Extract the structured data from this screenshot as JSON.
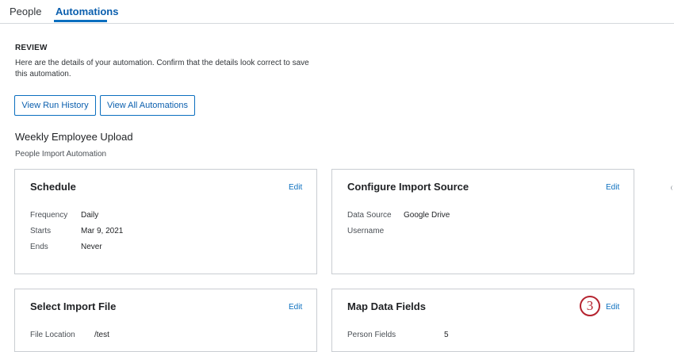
{
  "tabs": [
    {
      "label": "People"
    },
    {
      "label": "Automations"
    }
  ],
  "review": {
    "heading": "REVIEW",
    "description": "Here are the details of your automation. Confirm that the details look correct to save this automation."
  },
  "buttons": {
    "view_run_history": "View Run History",
    "view_all_automations": "View All Automations"
  },
  "automation": {
    "name": "Weekly Employee Upload",
    "type": "People Import Automation"
  },
  "cards": {
    "schedule": {
      "title": "Schedule",
      "edit": "Edit",
      "fields": [
        {
          "label": "Frequency",
          "value": "Daily"
        },
        {
          "label": "Starts",
          "value": "Mar 9, 2021"
        },
        {
          "label": "Ends",
          "value": "Never"
        }
      ]
    },
    "import_source": {
      "title": "Configure Import Source",
      "edit": "Edit",
      "fields": [
        {
          "label": "Data Source",
          "value": "Google Drive"
        },
        {
          "label": "Username",
          "value": ""
        }
      ]
    },
    "import_file": {
      "title": "Select Import File",
      "edit": "Edit",
      "fields": [
        {
          "label": "File Location",
          "value": "/test"
        }
      ]
    },
    "map_fields": {
      "title": "Map Data Fields",
      "edit": "Edit",
      "fields": [
        {
          "label": "Person Fields",
          "value": "5"
        }
      ]
    }
  },
  "annotation": {
    "step_number": "3",
    "accent_color": "#b5232f"
  },
  "colors": {
    "link": "#0b6fbf",
    "border": "#c9cdd2"
  }
}
